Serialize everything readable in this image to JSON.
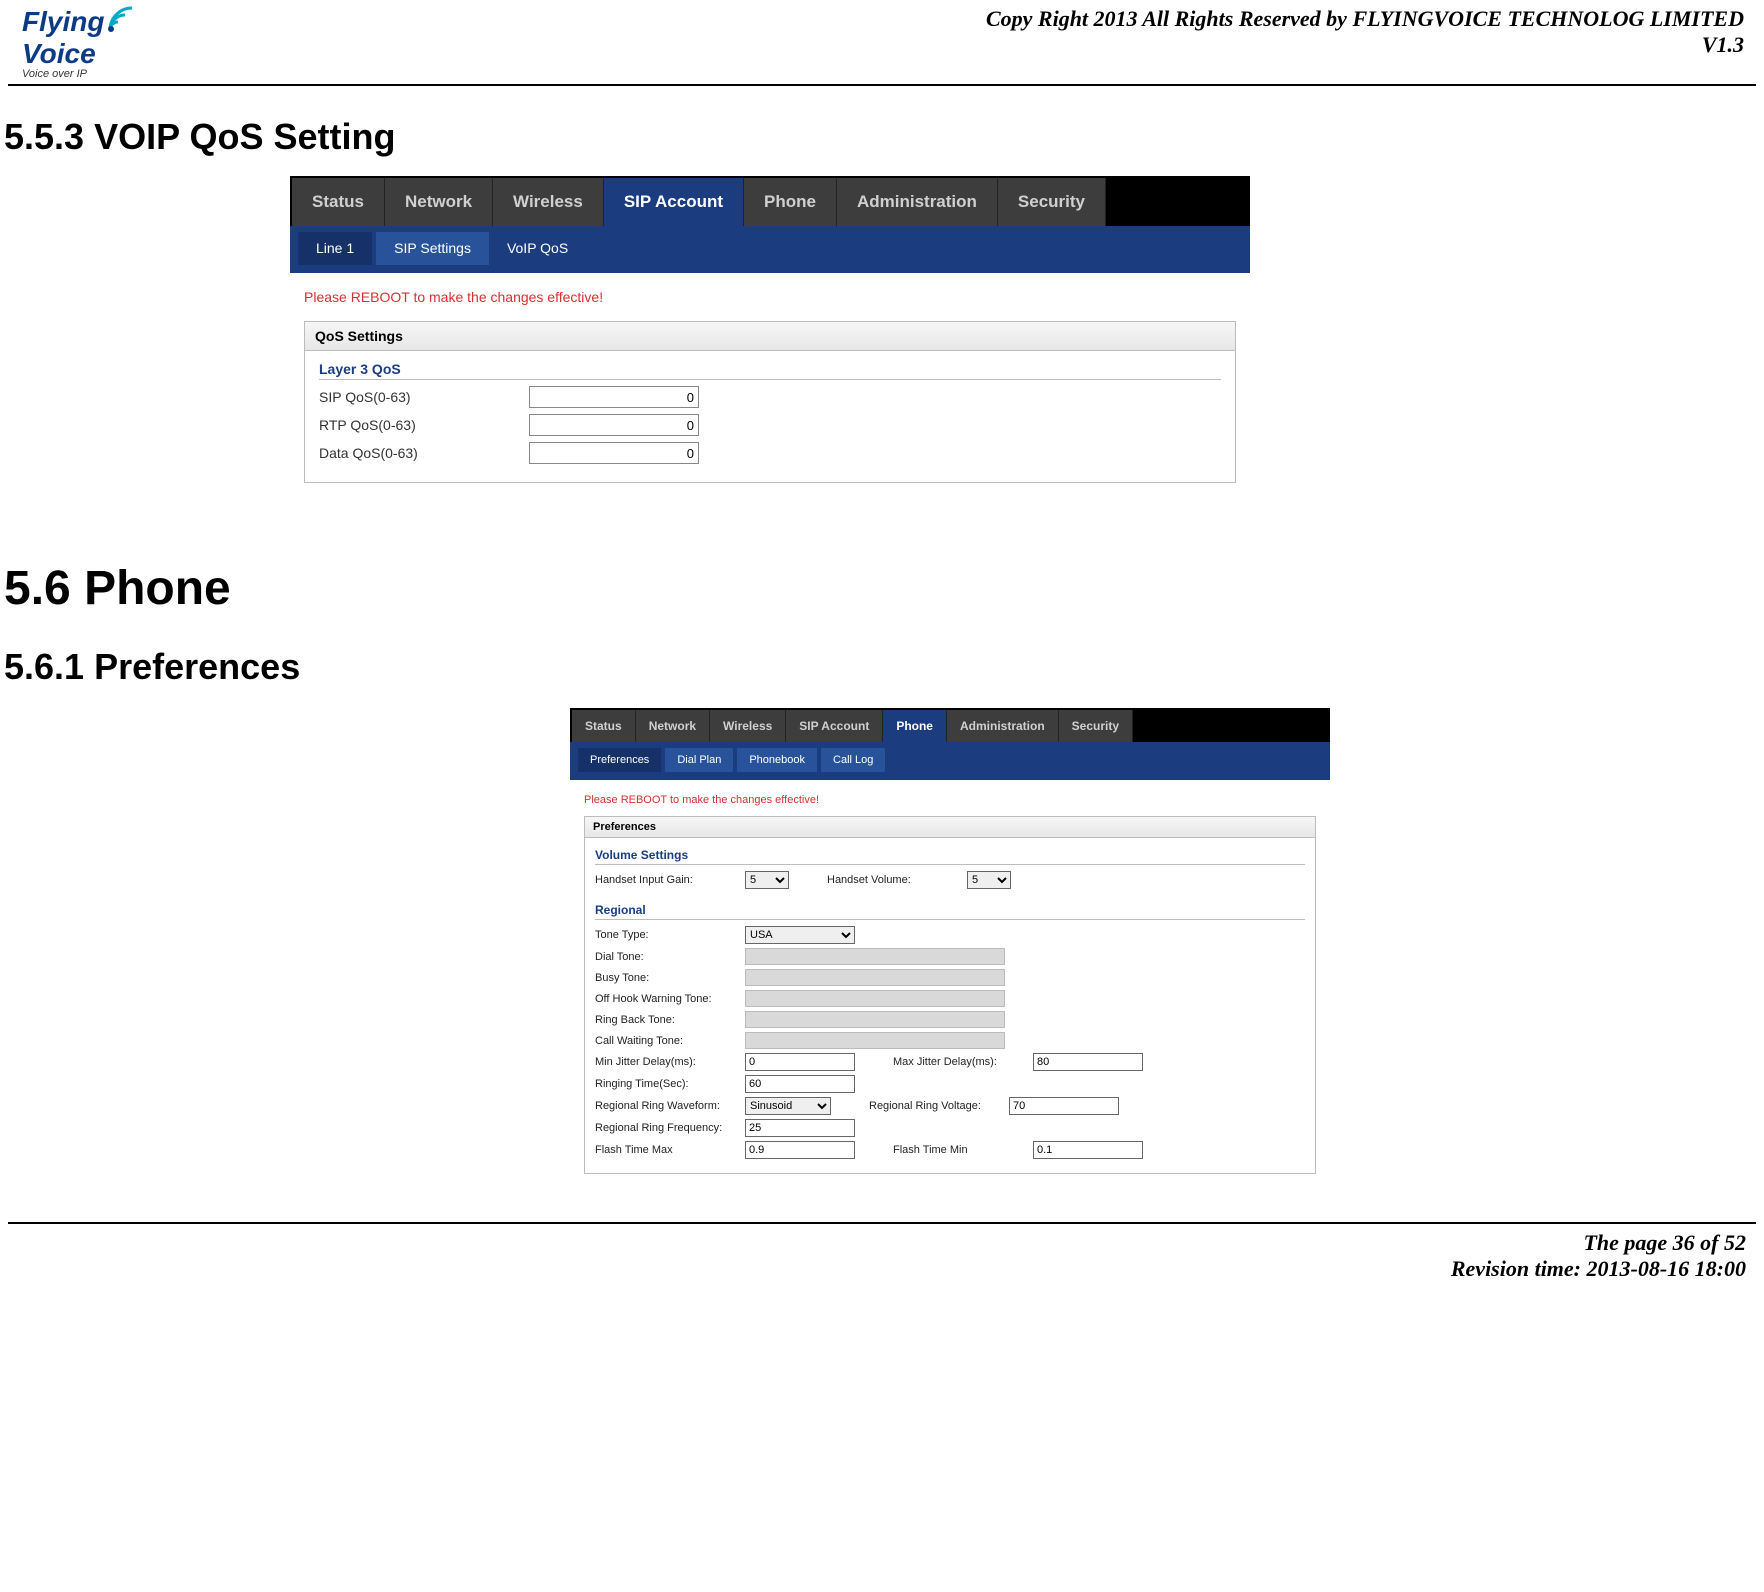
{
  "header": {
    "logo_flying": "Flying",
    "logo_voice": "Voice",
    "logo_sub": "Voice over IP",
    "copyright": "Copy Right 2013 All Rights Reserved by FLYINGVOICE TECHNOLOG LIMITED",
    "version": "V1.3"
  },
  "sections": {
    "s553": "5.5.3 VOIP QoS Setting",
    "s56": "5.6 Phone",
    "s561": "5.6.1 Preferences"
  },
  "ss1": {
    "tabs": [
      "Status",
      "Network",
      "Wireless",
      "SIP Account",
      "Phone",
      "Administration",
      "Security"
    ],
    "subtabs": [
      "Line 1",
      "SIP Settings",
      "VoIP QoS"
    ],
    "reboot": "Please REBOOT to make the changes effective!",
    "box_title": "QoS Settings",
    "sect": "Layer 3 QoS",
    "rows": {
      "sip_lbl": "SIP QoS(0-63)",
      "sip_val": "0",
      "rtp_lbl": "RTP QoS(0-63)",
      "rtp_val": "0",
      "data_lbl": "Data QoS(0-63)",
      "data_val": "0"
    }
  },
  "ss2": {
    "tabs": [
      "Status",
      "Network",
      "Wireless",
      "SIP Account",
      "Phone",
      "Administration",
      "Security"
    ],
    "subtabs": [
      "Preferences",
      "Dial Plan",
      "Phonebook",
      "Call Log"
    ],
    "reboot": "Please REBOOT to make the changes effective!",
    "box_title": "Preferences",
    "sect_vol": "Volume Settings",
    "vol": {
      "in_gain_lbl": "Handset Input Gain:",
      "in_gain_val": "5",
      "vol_lbl": "Handset Volume:",
      "vol_val": "5"
    },
    "sect_reg": "Regional",
    "reg": {
      "tone_type_lbl": "Tone Type:",
      "tone_type_val": "USA",
      "dial_tone_lbl": "Dial Tone:",
      "busy_tone_lbl": "Busy Tone:",
      "offhook_lbl": "Off Hook Warning Tone:",
      "ringback_lbl": "Ring Back Tone:",
      "callwait_lbl": "Call Waiting Tone:",
      "min_jitter_lbl": "Min Jitter Delay(ms):",
      "min_jitter_val": "0",
      "max_jitter_lbl": "Max Jitter Delay(ms):",
      "max_jitter_val": "80",
      "ring_time_lbl": "Ringing Time(Sec):",
      "ring_time_val": "60",
      "waveform_lbl": "Regional Ring Waveform:",
      "waveform_val": "Sinusoid",
      "voltage_lbl": "Regional Ring Voltage:",
      "voltage_val": "70",
      "freq_lbl": "Regional Ring Frequency:",
      "freq_val": "25",
      "flash_max_lbl": "Flash Time Max",
      "flash_max_val": "0.9",
      "flash_min_lbl": "Flash Time Min",
      "flash_min_val": "0.1"
    }
  },
  "footer": {
    "page": "The page 36 of 52",
    "rev": "Revision time: 2013-08-16 18:00"
  }
}
